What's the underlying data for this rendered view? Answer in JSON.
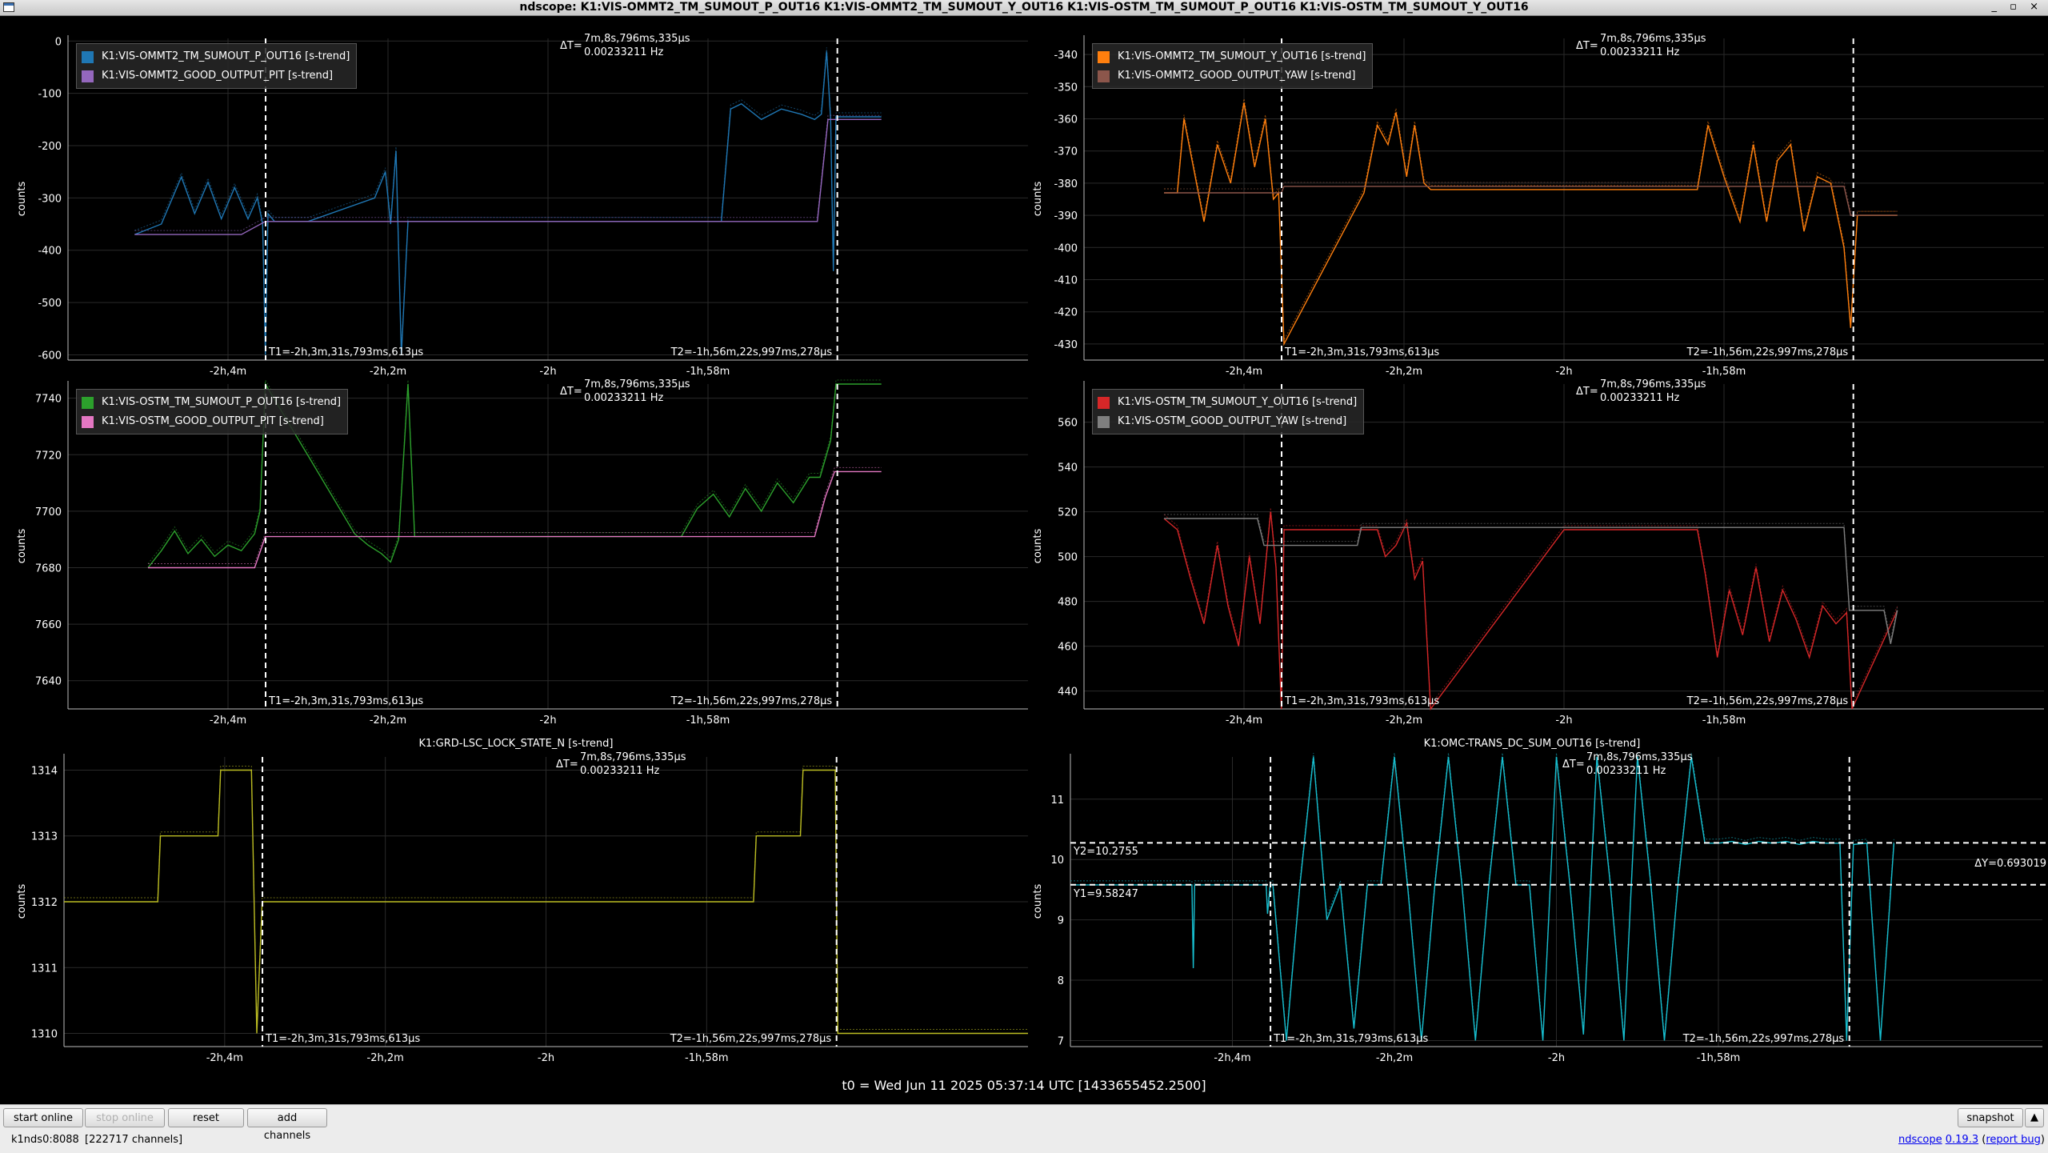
{
  "window": {
    "title": "ndscope: K1:VIS-OMMT2_TM_SUMOUT_P_OUT16 K1:VIS-OMMT2_TM_SUMOUT_Y_OUT16 K1:VIS-OSTM_TM_SUMOUT_P_OUT16 K1:VIS-OSTM_TM_SUMOUT_Y_OUT16",
    "controls": "_ ▫ ×"
  },
  "cursors": {
    "t1": "T1=-2h,3m,31s,793ms,613µs",
    "t2": "T2=-1h,56m,22s,997ms,278µs",
    "dt_label": "ΔT=",
    "dt_value": "7m,8s,796ms,335µs",
    "dt_freq": "0.00233211 Hz"
  },
  "time_axis": {
    "ticks": [
      "-2h,4m",
      "-2h,2m",
      "-2h",
      "-1h,58m"
    ]
  },
  "t0_label": "t0 = Wed Jun 11 2025 05:37:14 UTC [1433655452.2500]",
  "colors": {
    "background": "#000000",
    "grid": "#2a2a2a",
    "cursor": "#ffffff"
  },
  "plots": [
    {
      "id": "p1",
      "ylabel": "counts",
      "title": "",
      "yticks": [
        "0",
        "-100",
        "-200",
        "-300",
        "-400",
        "-500",
        "-600"
      ],
      "legend": [
        {
          "label": "K1:VIS-OMMT2_TM_SUMOUT_P_OUT16 [s-trend]",
          "color": "#1f77b4"
        },
        {
          "label": "K1:VIS-OMMT2_GOOD_OUTPUT_PIT [s-trend]",
          "color": "#9467bd"
        }
      ]
    },
    {
      "id": "p2",
      "ylabel": "counts",
      "title": "",
      "yticks": [
        "-340",
        "-350",
        "-360",
        "-370",
        "-380",
        "-390",
        "-400",
        "-410",
        "-420",
        "-430"
      ],
      "legend": [
        {
          "label": "K1:VIS-OMMT2_TM_SUMOUT_Y_OUT16 [s-trend]",
          "color": "#ff7f0e"
        },
        {
          "label": "K1:VIS-OMMT2_GOOD_OUTPUT_YAW [s-trend]",
          "color": "#8c564b"
        }
      ]
    },
    {
      "id": "p3",
      "ylabel": "counts",
      "title": "",
      "yticks": [
        "7740",
        "7720",
        "7700",
        "7680",
        "7660",
        "7640"
      ],
      "legend": [
        {
          "label": "K1:VIS-OSTM_TM_SUMOUT_P_OUT16 [s-trend]",
          "color": "#2ca02c"
        },
        {
          "label": "K1:VIS-OSTM_GOOD_OUTPUT_PIT [s-trend]",
          "color": "#e377c2"
        }
      ]
    },
    {
      "id": "p4",
      "ylabel": "counts",
      "title": "",
      "yticks": [
        "560",
        "540",
        "520",
        "500",
        "480",
        "460",
        "440"
      ],
      "legend": [
        {
          "label": "K1:VIS-OSTM_TM_SUMOUT_Y_OUT16 [s-trend]",
          "color": "#d62728"
        },
        {
          "label": "K1:VIS-OSTM_GOOD_OUTPUT_YAW [s-trend]",
          "color": "#7f7f7f"
        }
      ]
    },
    {
      "id": "p5",
      "ylabel": "counts",
      "title": "K1:GRD-LSC_LOCK_STATE_N [s-trend]",
      "yticks": [
        "1314",
        "1313",
        "1312",
        "1311",
        "1310"
      ],
      "legend": []
    },
    {
      "id": "p6",
      "ylabel": "counts",
      "title": "K1:OMC-TRANS_DC_SUM_OUT16 [s-trend]",
      "yticks": [
        "11",
        "10",
        "9",
        "8",
        "7"
      ],
      "legend": [],
      "y_cursors": {
        "y1": "Y1=9.58247",
        "y2": "Y2=10.2755",
        "dy": "ΔY=0.693019"
      }
    }
  ],
  "chart_data": [
    {
      "type": "line",
      "title": "",
      "xlabel": "",
      "ylabel": "counts",
      "x_range_s": [
        -7560,
        -6840
      ],
      "ylim": [
        -610,
        5
      ],
      "cursor_x_s": [
        -7411.79,
        -6982.99
      ],
      "series": [
        {
          "name": "K1:VIS-OMMT2_TM_SUMOUT_P_OUT16 [s-trend]",
          "color": "#1f77b4",
          "x": [
            -7510,
            -7490,
            -7475,
            -7465,
            -7455,
            -7445,
            -7435,
            -7425,
            -7418,
            -7414,
            -7412,
            -7410,
            -7405,
            -7380,
            -7330,
            -7322,
            -7318,
            -7314,
            -7310,
            -7305,
            -7300,
            -7200,
            -7100,
            -7070,
            -7063,
            -7055,
            -7040,
            -7025,
            -7010,
            -7000,
            -6995,
            -6991,
            -6988,
            -6986,
            -6984,
            -6980,
            -6950
          ],
          "y": [
            -370,
            -350,
            -260,
            -330,
            -270,
            -340,
            -280,
            -340,
            -300,
            -350,
            -600,
            -330,
            -345,
            -345,
            -300,
            -250,
            -350,
            -210,
            -600,
            -345,
            -345,
            -345,
            -345,
            -345,
            -130,
            -120,
            -150,
            -130,
            -140,
            -150,
            -140,
            -20,
            -150,
            -440,
            -145,
            -145,
            -145
          ]
        },
        {
          "name": "K1:VIS-OMMT2_GOOD_OUTPUT_PIT [s-trend]",
          "color": "#9467bd",
          "x": [
            -7510,
            -7430,
            -7412,
            -7100,
            -6998,
            -6990,
            -6950
          ],
          "y": [
            -370,
            -370,
            -345,
            -345,
            -345,
            -150,
            -150
          ]
        }
      ]
    },
    {
      "type": "line",
      "title": "",
      "xlabel": "",
      "ylabel": "counts",
      "x_range_s": [
        -7560,
        -6840
      ],
      "ylim": [
        -435,
        -335
      ],
      "cursor_x_s": [
        -7411.79,
        -6982.99
      ],
      "series": [
        {
          "name": "K1:VIS-OMMT2_TM_SUMOUT_Y_OUT16 [s-trend]",
          "color": "#ff7f0e",
          "x": [
            -7500,
            -7490,
            -7485,
            -7478,
            -7470,
            -7460,
            -7450,
            -7440,
            -7432,
            -7424,
            -7418,
            -7414,
            -7410,
            -7350,
            -7340,
            -7332,
            -7326,
            -7318,
            -7312,
            -7305,
            -7300,
            -7200,
            -7100,
            -7092,
            -7080,
            -7068,
            -7058,
            -7048,
            -7040,
            -7030,
            -7020,
            -7010,
            -7000,
            -6990,
            -6985,
            -6980,
            -6950
          ],
          "y": [
            -383,
            -383,
            -360,
            -375,
            -392,
            -368,
            -380,
            -355,
            -375,
            -360,
            -385,
            -383,
            -430,
            -383,
            -362,
            -368,
            -358,
            -378,
            -362,
            -380,
            -382,
            -382,
            -382,
            -362,
            -378,
            -392,
            -368,
            -392,
            -373,
            -368,
            -395,
            -378,
            -380,
            -400,
            -425,
            -390,
            -390
          ]
        },
        {
          "name": "K1:VIS-OMMT2_GOOD_OUTPUT_YAW [s-trend]",
          "color": "#8c564b",
          "x": [
            -7500,
            -7412,
            -7410,
            -7100,
            -6990,
            -6985,
            -6950
          ],
          "y": [
            -383,
            -383,
            -381,
            -381,
            -381,
            -390,
            -390
          ]
        }
      ]
    },
    {
      "type": "line",
      "title": "",
      "xlabel": "",
      "ylabel": "counts",
      "x_range_s": [
        -7560,
        -6840
      ],
      "ylim": [
        7630,
        7745
      ],
      "cursor_x_s": [
        -7411.79,
        -6982.99
      ],
      "series": [
        {
          "name": "K1:VIS-OSTM_TM_SUMOUT_P_OUT16 [s-trend]",
          "color": "#2ca02c",
          "x": [
            -7500,
            -7490,
            -7480,
            -7470,
            -7460,
            -7450,
            -7440,
            -7430,
            -7420,
            -7416,
            -7412,
            -7345,
            -7335,
            -7325,
            -7318,
            -7312,
            -7305,
            -7300,
            -7200,
            -7100,
            -7088,
            -7076,
            -7064,
            -7052,
            -7040,
            -7028,
            -7016,
            -7004,
            -6996,
            -6988,
            -6984,
            -6950
          ],
          "y": [
            7680,
            7686,
            7693,
            7685,
            7690,
            7684,
            7688,
            7686,
            7692,
            7700,
            7745,
            7692,
            7688,
            7685,
            7682,
            7690,
            7745,
            7691,
            7691,
            7691,
            7701,
            7706,
            7698,
            7708,
            7700,
            7710,
            7703,
            7712,
            7712,
            7725,
            7745,
            7745
          ]
        },
        {
          "name": "K1:VIS-OSTM_GOOD_OUTPUT_PIT [s-trend]",
          "color": "#e377c2",
          "x": [
            -7500,
            -7420,
            -7412,
            -7100,
            -7000,
            -6992,
            -6985,
            -6950
          ],
          "y": [
            7680,
            7680,
            7691,
            7691,
            7691,
            7705,
            7714,
            7714
          ]
        }
      ]
    },
    {
      "type": "line",
      "title": "",
      "xlabel": "",
      "ylabel": "counts",
      "x_range_s": [
        -7560,
        -6840
      ],
      "ylim": [
        432,
        577
      ],
      "cursor_x_s": [
        -7411.79,
        -6982.99
      ],
      "series": [
        {
          "name": "K1:VIS-OSTM_TM_SUMOUT_Y_OUT16 [s-trend]",
          "color": "#d62728",
          "x": [
            -7500,
            -7490,
            -7480,
            -7470,
            -7460,
            -7452,
            -7444,
            -7436,
            -7428,
            -7420,
            -7416,
            -7412,
            -7410,
            -7340,
            -7334,
            -7326,
            -7318,
            -7312,
            -7306,
            -7300,
            -7200,
            -7100,
            -7094,
            -7085,
            -7076,
            -7066,
            -7056,
            -7046,
            -7036,
            -7026,
            -7016,
            -7006,
            -6996,
            -6988,
            -6984,
            -6950
          ],
          "y": [
            517,
            512,
            490,
            470,
            505,
            478,
            460,
            500,
            470,
            520,
            495,
            432,
            512,
            512,
            500,
            505,
            515,
            490,
            498,
            432,
            512,
            512,
            492,
            455,
            485,
            465,
            495,
            462,
            485,
            472,
            455,
            478,
            470,
            475,
            432,
            476
          ]
        },
        {
          "name": "K1:VIS-OSTM_GOOD_OUTPUT_YAW [s-trend]",
          "color": "#7f7f7f",
          "x": [
            -7500,
            -7430,
            -7425,
            -7412,
            -7355,
            -7352,
            -7100,
            -6990,
            -6986,
            -6978,
            -6960,
            -6955,
            -6950
          ],
          "y": [
            517,
            517,
            505,
            505,
            505,
            513,
            513,
            513,
            476,
            476,
            476,
            461,
            476
          ]
        }
      ]
    },
    {
      "type": "line",
      "title": "K1:GRD-LSC_LOCK_STATE_N [s-trend]",
      "xlabel": "",
      "ylabel": "counts",
      "x_range_s": [
        -7560,
        -6840
      ],
      "ylim": [
        1309.8,
        1314.2
      ],
      "cursor_x_s": [
        -7411.79,
        -6982.99
      ],
      "series": [
        {
          "name": "",
          "color": "#bcbd22",
          "x": [
            -7560,
            -7490,
            -7488,
            -7445,
            -7443,
            -7420,
            -7416,
            -7412,
            -7410,
            -7100,
            -7045,
            -7043,
            -7010,
            -7008,
            -6984,
            -6982,
            -6840
          ],
          "y": [
            1312,
            1312,
            1313,
            1313,
            1314,
            1314,
            1310,
            1312,
            1312,
            1312,
            1312,
            1313,
            1313,
            1314,
            1314,
            1310,
            1310
          ]
        }
      ]
    },
    {
      "type": "line",
      "title": "K1:OMC-TRANS_DC_SUM_OUT16 [s-trend]",
      "xlabel": "",
      "ylabel": "counts",
      "x_range_s": [
        -7560,
        -6840
      ],
      "ylim": [
        6.9,
        11.7
      ],
      "cursor_x_s": [
        -7411.79,
        -6982.99
      ],
      "y_cursors": [
        9.58247,
        10.2755
      ],
      "series": [
        {
          "name": "",
          "color": "#17becf",
          "x": [
            -7560,
            -7480,
            -7470,
            -7469,
            -7468,
            -7440,
            -7415,
            -7414,
            -7412,
            -7410,
            -7400,
            -7390,
            -7380,
            -7370,
            -7360,
            -7350,
            -7340,
            -7330,
            -7320,
            -7310,
            -7300,
            -7290,
            -7280,
            -7270,
            -7260,
            -7250,
            -7240,
            -7230,
            -7220,
            -7210,
            -7200,
            -7190,
            -7180,
            -7170,
            -7160,
            -7150,
            -7140,
            -7130,
            -7120,
            -7110,
            -7100,
            -7090,
            -7080,
            -7070,
            -7060,
            -7050,
            -7040,
            -7030,
            -7020,
            -7010,
            -7000,
            -6990,
            -6985,
            -6980,
            -6970,
            -6960,
            -6950
          ],
          "y": [
            9.58,
            9.58,
            9.58,
            8.2,
            9.58,
            9.58,
            9.58,
            9.1,
            9.58,
            9.58,
            7.0,
            9.58,
            11.7,
            9.0,
            9.58,
            7.2,
            9.58,
            9.58,
            11.7,
            9.5,
            7.0,
            9.58,
            11.7,
            9.58,
            7.0,
            9.58,
            11.7,
            9.58,
            9.58,
            7.0,
            11.7,
            9.58,
            7.1,
            11.7,
            9.58,
            7.0,
            11.7,
            9.58,
            7.0,
            9.58,
            11.7,
            10.27,
            10.27,
            10.3,
            10.25,
            10.3,
            10.27,
            10.3,
            10.25,
            10.3,
            10.27,
            10.27,
            7.0,
            10.25,
            10.27,
            7.0,
            10.27
          ]
        }
      ]
    }
  ],
  "toolbar": {
    "start_online": "start online",
    "stop_online": "stop online",
    "reset": "reset",
    "add_channels": "add channels",
    "snapshot": "snapshot",
    "snapshot_arrow": "▲",
    "server": "k1nds0:8088",
    "channels": "[222717 channels]",
    "app_name": "ndscope",
    "version": "0.19.3",
    "open_paren": "(",
    "report_bug": "report bug",
    "close_paren": ")"
  }
}
